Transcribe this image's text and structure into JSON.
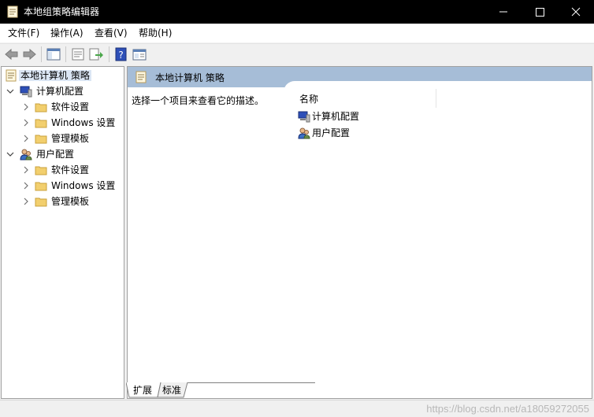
{
  "window": {
    "title": "本地组策略编辑器",
    "minimize": "—",
    "maximize": "☐",
    "close": "✕"
  },
  "menu": [
    {
      "label": "文件(F)"
    },
    {
      "label": "操作(A)"
    },
    {
      "label": "查看(V)"
    },
    {
      "label": "帮助(H)"
    }
  ],
  "toolbar": {
    "buttons": [
      "back-icon",
      "forward-icon",
      "show-hide-tree-icon",
      "properties-icon",
      "export-list-icon",
      "help-icon",
      "extended-view-icon"
    ]
  },
  "tree": {
    "root": "本地计算机 策略",
    "computer_config": "计算机配置",
    "user_config": "用户配置",
    "software_settings": "软件设置",
    "windows_settings": "Windows 设置",
    "admin_templates": "管理模板"
  },
  "right_pane": {
    "header_title": "本地计算机 策略",
    "description": "选择一个项目来查看它的描述。",
    "column_name": "名称",
    "items": [
      {
        "label": "计算机配置"
      },
      {
        "label": "用户配置"
      }
    ]
  },
  "tabs": [
    {
      "label": "扩展"
    },
    {
      "label": "标准"
    }
  ],
  "status": {
    "watermark": "https://blog.csdn.net/a18059272055"
  },
  "colors": {
    "titlebar": "#000000",
    "header_band": "#a6bdd7",
    "folder": "#f2cf6e",
    "selection": "#dbe6f4"
  }
}
